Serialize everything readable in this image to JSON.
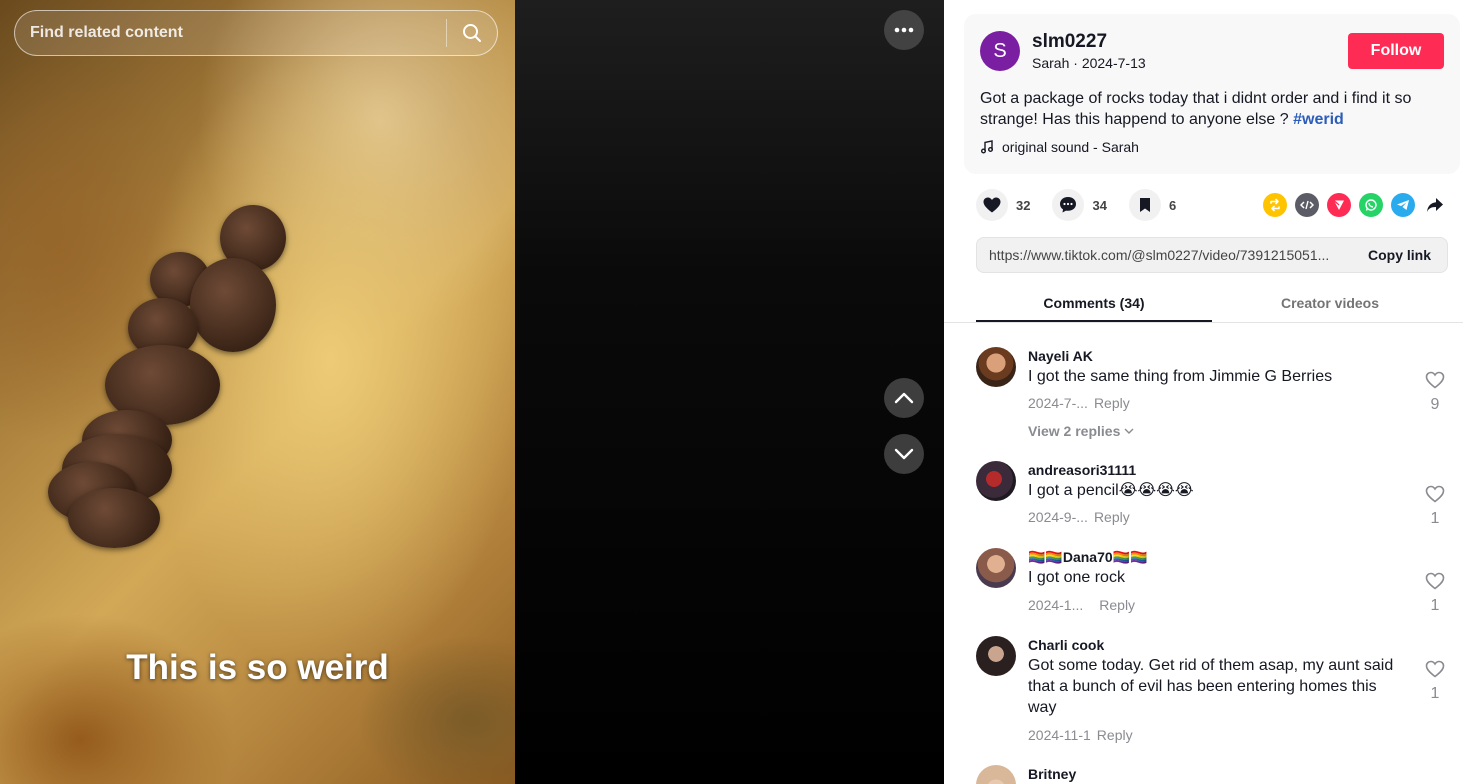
{
  "search": {
    "placeholder": "Find related content"
  },
  "video": {
    "caption": "This is so weird"
  },
  "post": {
    "avatar_letter": "S",
    "username": "slm0227",
    "display_name": "Sarah",
    "date": "2024-7-13",
    "meta_separator": "·",
    "follow_label": "Follow",
    "description": "Got a package of rocks today that i didnt order and i find it so strange! Has this happend to anyone else ? ",
    "hashtag": "#werid",
    "sound": "original sound - Sarah"
  },
  "actions": {
    "likes": "32",
    "comments": "34",
    "saves": "6"
  },
  "share_icons": [
    "repost-icon",
    "embed-icon",
    "send-icon",
    "whatsapp-icon",
    "telegram-icon",
    "share-arrow-icon"
  ],
  "link": {
    "url": "https://www.tiktok.com/@slm0227/video/7391215051...",
    "copy_label": "Copy link"
  },
  "tabs": [
    {
      "label": "Comments (34)",
      "active": true
    },
    {
      "label": "Creator videos",
      "active": false
    }
  ],
  "comments": [
    {
      "user": "Nayeli AK",
      "text": "I got the same thing from Jimmie G Berries",
      "date": "2024-7-...",
      "reply": "Reply",
      "likes": "9",
      "view_replies": "View 2 replies"
    },
    {
      "user": "andreasori31111",
      "text": "I got a pencil😭😭😭😭",
      "date": "2024-9-...",
      "reply": "Reply",
      "likes": "1"
    },
    {
      "user": "🏳️‍🌈🏳️‍🌈Dana70🏳️‍🌈🏳️‍🌈",
      "text": "I got one rock",
      "date": "2024-1...",
      "reply": "Reply",
      "likes": "1"
    },
    {
      "user": "Charli cook",
      "text": "Got some today. Get rid of them asap, my aunt said that a bunch of evil has been entering homes this way",
      "date": "2024-11-1",
      "reply": "Reply",
      "likes": "1"
    },
    {
      "user": "Britney"
    }
  ],
  "colors": {
    "follow": "#fe2c55",
    "hashtag": "#2b5db9",
    "avatar": "#7b1fa2"
  }
}
